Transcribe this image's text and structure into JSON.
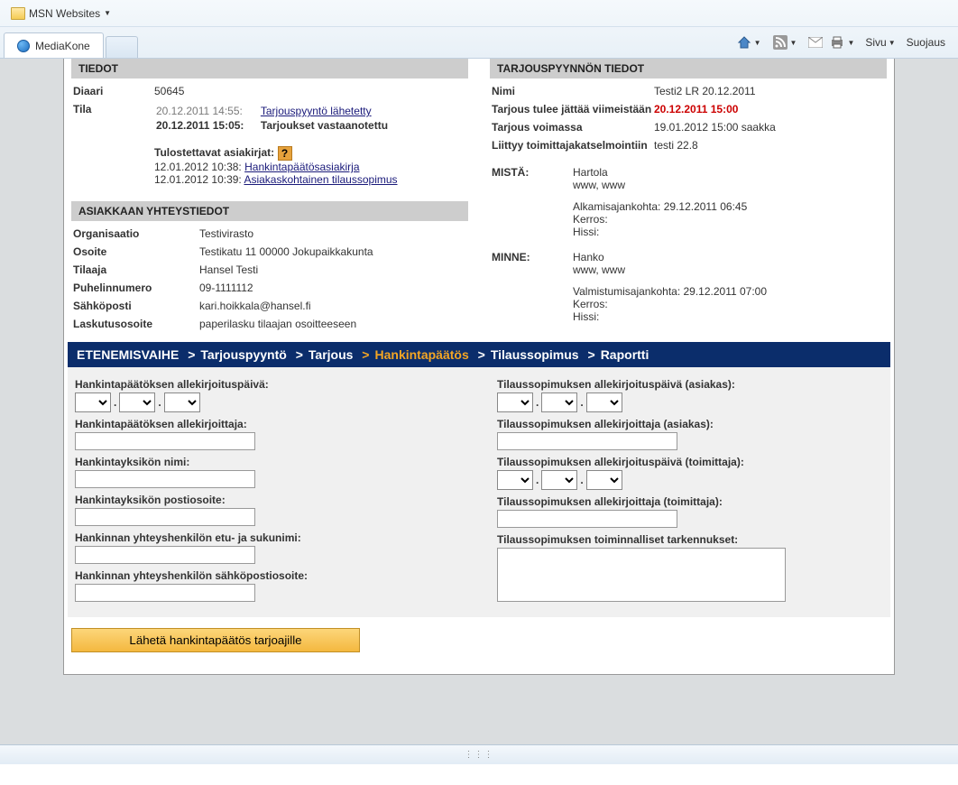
{
  "browser": {
    "favorites_item": "MSN Websites",
    "tab_title": "MediaKone",
    "toolbar": {
      "page": "Sivu",
      "safety": "Suojaus"
    }
  },
  "left": {
    "header": "TIEDOT",
    "diaari_label": "Diaari",
    "diaari_value": "50645",
    "tila_label": "Tila",
    "tila_ts1": "20.12.2011 14:55:",
    "tila_link1": "Tarjouspyyntö lähetetty",
    "tila_ts2": "20.12.2011 15:05:",
    "tila_text2": "Tarjoukset vastaanotettu",
    "docs_label": "Tulostettavat asiakirjat:",
    "doc1_ts": "12.01.2012 10:38:",
    "doc1_link": "Hankintapäätösasiakirja",
    "doc2_ts": "12.01.2012 10:39:",
    "doc2_link": "Asiakaskohtainen tilaussopimus",
    "contact_header": "ASIAKKAAN YHTEYSTIEDOT",
    "org_label": "Organisaatio",
    "org_value": "Testivirasto",
    "addr_label": "Osoite",
    "addr_value": "Testikatu 11 00000 Jokupaikkakunta",
    "tilaaja_label": "Tilaaja",
    "tilaaja_value": "Hansel Testi",
    "phone_label": "Puhelinnumero",
    "phone_value": "09-1111112",
    "email_label": "Sähköposti",
    "email_value": "kari.hoikkala@hansel.fi",
    "billaddr_label": "Laskutusosoite",
    "billaddr_value": "paperilasku tilaajan osoitteeseen"
  },
  "right": {
    "header": "TARJOUSPYYNNÖN TIEDOT",
    "nimi_label": "Nimi",
    "nimi_value": "Testi2 LR 20.12.2011",
    "deadline_label": "Tarjous tulee jättää viimeistään",
    "deadline_value": "20.12.2011 15:00",
    "valid_label": "Tarjous voimassa",
    "valid_value": "19.01.2012 15:00 saakka",
    "liittyy_label": "Liittyy toimittajakatselmointiin",
    "liittyy_value": "testi 22.8",
    "from_label": "MISTÄ:",
    "from_city": "Hartola",
    "from_www": "www, www",
    "from_start": "Alkamisajankohta: 29.12.2011 06:45",
    "from_floor": "Kerros:",
    "from_elev": "Hissi:",
    "to_label": "MINNE:",
    "to_city": "Hanko",
    "to_www": "www, www",
    "to_done": "Valmistumisajankohta: 29.12.2011 07:00",
    "to_floor": "Kerros:",
    "to_elev": "Hissi:"
  },
  "progress": {
    "title": "ETENEMISVAIHE",
    "s1": "Tarjouspyyntö",
    "s2": "Tarjous",
    "s3": "Hankintapäätös",
    "s4": "Tilaussopimus",
    "s5": "Raportti"
  },
  "form": {
    "l_sign_date": "Hankintapäätöksen allekirjoituspäivä:",
    "l_signer": "Hankintapäätöksen allekirjoittaja:",
    "l_unit_name": "Hankintayksikön nimi:",
    "l_unit_addr": "Hankintayksikön postiosoite:",
    "l_contact_name": "Hankinnan yhteyshenkilön etu- ja sukunimi:",
    "l_contact_email": "Hankinnan yhteyshenkilön sähköpostiosoite:",
    "r_sign_date_cust": "Tilaussopimuksen allekirjoituspäivä (asiakas):",
    "r_signer_cust": "Tilaussopimuksen allekirjoittaja (asiakas):",
    "r_sign_date_supp": "Tilaussopimuksen allekirjoituspäivä (toimittaja):",
    "r_signer_supp": "Tilaussopimuksen allekirjoittaja (toimittaja):",
    "r_notes": "Tilaussopimuksen toiminnalliset tarkennukset:",
    "submit": "Lähetä hankintapäätös tarjoajille"
  }
}
